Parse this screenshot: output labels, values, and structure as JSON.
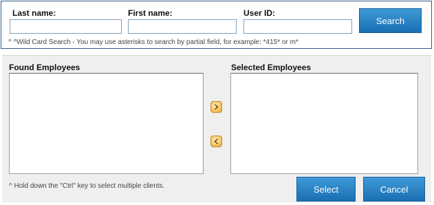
{
  "search": {
    "last_name_label": "Last name:",
    "first_name_label": "First name:",
    "user_id_label": "User ID:",
    "last_name_value": "",
    "first_name_value": "",
    "user_id_value": "",
    "search_button": "Search",
    "hint": "^ ^Wild Card Search - You may use asterisks to search by partial field, for example: *415* or m*"
  },
  "lists": {
    "found_label": "Found Employees",
    "selected_label": "Selected Employees",
    "add_icon": "chevron-right-icon",
    "remove_icon": "chevron-left-icon",
    "hint": "^ Hold down the \"Ctrl\" key to select multiple clients.",
    "select_button": "Select",
    "cancel_button": "Cancel"
  },
  "colors": {
    "button_blue": "#1a6eb2",
    "panel_border": "#2d5c8a",
    "arrow_orange": "#e19a2b"
  }
}
